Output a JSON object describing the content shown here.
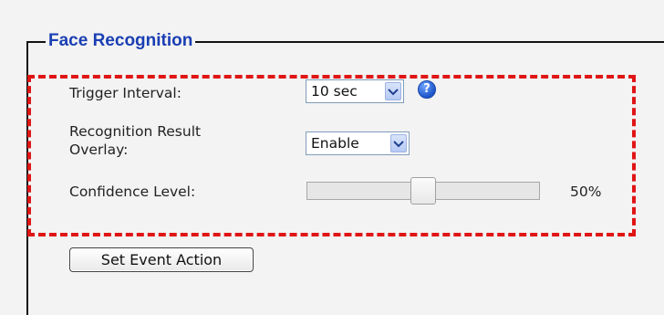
{
  "section": {
    "title": "Face Recognition"
  },
  "fields": {
    "trigger_interval": {
      "label": "Trigger Interval:",
      "value": "10 sec"
    },
    "overlay": {
      "label_line1": "Recognition Result",
      "label_line2": "Overlay:",
      "value": "Enable"
    },
    "confidence": {
      "label": "Confidence Level:",
      "percent": 50,
      "value_text": "50%"
    }
  },
  "help": {
    "glyph": "?"
  },
  "actions": {
    "set_event_action": "Set Event Action"
  },
  "colors": {
    "title": "#1a3fb3",
    "highlight": "#e01515",
    "help_icon": "#1e56c9"
  },
  "icons": {
    "help": "help-icon",
    "dropdown": "chevron-down-icon"
  }
}
